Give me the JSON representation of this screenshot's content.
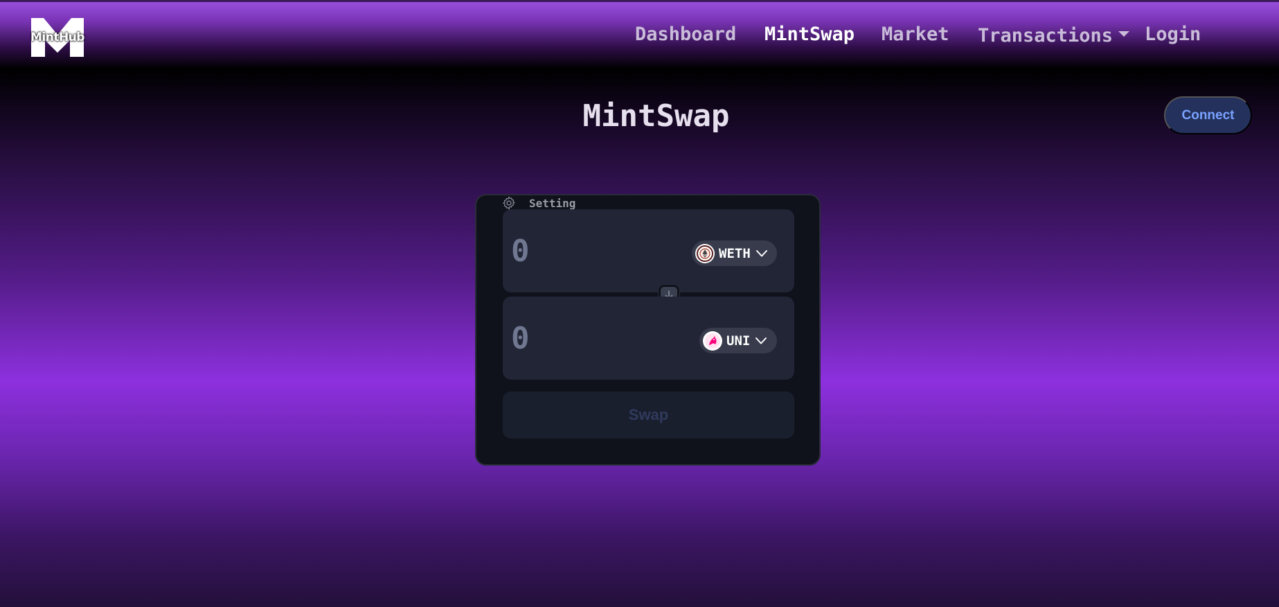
{
  "navbar": {
    "logo_text": "MintHub",
    "links": [
      {
        "label": "Dashboard",
        "active": false
      },
      {
        "label": "MintSwap",
        "active": true
      },
      {
        "label": "Market",
        "active": false
      },
      {
        "label": "Transactions",
        "active": false,
        "dropdown": true
      },
      {
        "label": "Login",
        "active": false
      }
    ]
  },
  "page": {
    "title": "MintSwap",
    "connect_label": "Connect"
  },
  "swap": {
    "settings_label": "Setting",
    "sell": {
      "placeholder": "0",
      "token": "WETH",
      "icon": "weth-token-icon"
    },
    "buy": {
      "placeholder": "0",
      "token": "UNI",
      "icon": "uni-token-icon"
    },
    "swap_label": "Swap"
  },
  "colors": {
    "accent_purple": "#8d30de",
    "connect_bg": "#23315c",
    "connect_text": "#7aa2ff",
    "card_bg": "#0f121a",
    "token_box_bg": "#212535"
  }
}
